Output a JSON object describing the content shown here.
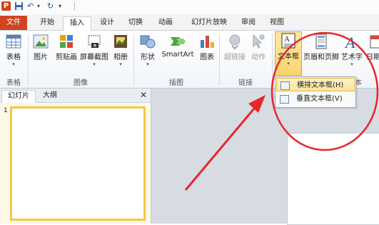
{
  "quick_access": {
    "app_icon": "P",
    "undo_icon": "↶",
    "redo_icon": "↻",
    "more_icon": "▾"
  },
  "tabs": [
    {
      "label": "文件"
    },
    {
      "label": "开始"
    },
    {
      "label": "插入"
    },
    {
      "label": "设计"
    },
    {
      "label": "切换"
    },
    {
      "label": "动画"
    },
    {
      "label": "幻灯片放映"
    },
    {
      "label": "审阅"
    },
    {
      "label": "视图"
    }
  ],
  "ribbon": {
    "groups": {
      "table": "表格",
      "images": "图像",
      "illustrations": "插图",
      "links": "链接",
      "text": "文本"
    },
    "buttons": {
      "table": "表格",
      "picture": "图片",
      "clipart": "剪贴画",
      "screenshot": "屏幕截图",
      "album": "相册",
      "shapes": "形状",
      "smartart": "SmartArt",
      "chart": "图表",
      "hyperlink": "超链接",
      "action": "动作",
      "textbox": "文本框",
      "header_footer": "页眉和页脚",
      "wordart": "艺术字",
      "datetime": "日期和"
    }
  },
  "textbox_menu": {
    "items": [
      {
        "label": "横排文本框(H)"
      },
      {
        "label": "垂直文本框(V)"
      }
    ]
  },
  "panel": {
    "tabs": [
      {
        "label": "幻灯片"
      },
      {
        "label": "大纲"
      }
    ],
    "close_icon": "✕",
    "slide_number": "1"
  },
  "colors": {
    "file_tab": "#d04420",
    "highlight": "#fbd46c",
    "annotation": "#e8262a"
  }
}
